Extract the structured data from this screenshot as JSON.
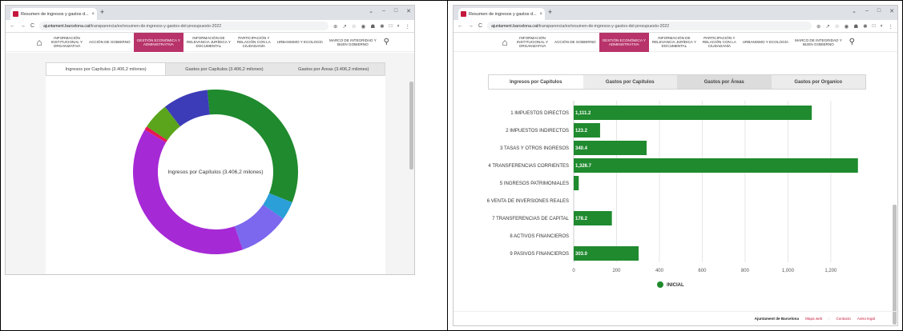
{
  "browser": {
    "tab_title": "Resumen de ingresos y gastos d...",
    "tab_close": "×",
    "new_tab": "+",
    "window_controls": [
      "⌄",
      "–",
      "□",
      "✕"
    ],
    "url_host": "ajuntament.barcelona.cat",
    "url_path": "/transparencia/es/resumen-de-ingresos-y-gastos-del-presupuesto-2022",
    "nav_back": "←",
    "nav_forward": "→",
    "nav_reload": "C",
    "lock": "🔒",
    "toolbar_icons": [
      "⊕",
      "↗",
      "☆",
      "◉",
      "☗",
      "✱",
      "□",
      "◐",
      "⋮"
    ]
  },
  "site_nav": {
    "home": "⌂",
    "items": [
      "INFORMACIÓN\nINSTITUCIONAL Y\nORGANIZATIVA",
      "ACCIÓN DE GOBIERNO",
      "GESTIÓN ECONÓMICA Y\nADMINISTRATIVA",
      "INFORMACIÓN DE\nRELEVANCIA JURÍDICA Y\nDOCUMENTAL",
      "PARTICIPACIÓN Y\nRELACIÓN CON LA\nCIUDADANÍA",
      "URBANISMO Y ECOLOGÍA",
      "MARCO DE INTEGRIDAD Y\nBUEN GOBIERNO"
    ],
    "active_index": 2,
    "search": "⚲"
  },
  "left_panel": {
    "tabs": [
      "Ingresos por Capítulos (3.406,2 milones)",
      "Gastos por Capítulos (3.406,2 milones)",
      "Gastos por Áreas (3.406,2 milones)"
    ],
    "donut_center_label": "Ingresos por Capítulos (3.406,2 milones)"
  },
  "right_panel": {
    "tabs": [
      "Ingresos por Capítulos",
      "Gastos por Capítulos",
      "Gastos por Áreas",
      "Gastos por Organico"
    ],
    "footer": {
      "brand": "Ajuntament de Barcelona",
      "links": [
        "Mapa web",
        "Contacto",
        "Aviso legal"
      ]
    }
  },
  "chart_data": [
    {
      "type": "pie",
      "title": "Ingresos por Capítulos (3.406,2 milones)",
      "categories": [
        "1 IMPUESTOS DIRECTOS",
        "2 IMPUESTOS INDIRECTOS",
        "3 TASAS Y OTROS INGRESOS",
        "4 TRANSFERENCIAS CORRIENTES",
        "5 INGRESOS PATRIMONIALES",
        "6 VENTA DE INVERSIONES REALES",
        "7 TRANSFERENCIAS DE CAPITAL",
        "8 ACTIVOS FINANCIEROS",
        "9 PASIVOS FINANCIEROS"
      ],
      "values": [
        1111.2,
        123.2,
        340.4,
        1326.7,
        23.6,
        0,
        178.2,
        0,
        303.0
      ],
      "colors": [
        "#1f8a2e",
        "#2a9fd8",
        "#7b68ee",
        "#a629d6",
        "#e8174f",
        "#999999",
        "#5aa51c",
        "#888888",
        "#3c3cb8"
      ]
    },
    {
      "type": "bar",
      "orientation": "horizontal",
      "categories": [
        "1 IMPUESTOS DIRECTOS",
        "2 IMPUESTOS INDIRECTOS",
        "3 TASAS Y OTROS INGRESOS",
        "4 TRANSFERENCIAS CORRIENTES",
        "5 INGRESOS PATRIMONIALES",
        "6 VENTA DE INVERSIONES REALES",
        "7 TRANSFERENCIAS DE CAPITAL",
        "8 ACTIVOS FINANCIEROS",
        "9 PASIVOS FINANCIEROS"
      ],
      "series": [
        {
          "name": "INICIAL",
          "values": [
            1111.2,
            123.2,
            340.4,
            1326.7,
            23.6,
            0,
            178.2,
            0,
            303.0
          ],
          "color": "#1f8a2e"
        }
      ],
      "data_labels": [
        "1,111.2",
        "123.2",
        "340.4",
        "1,326.7",
        "",
        "",
        "178.2",
        "",
        "303.0"
      ],
      "xticks": [
        "0",
        "200",
        "400",
        "600",
        "800",
        "1,000",
        "1,200"
      ],
      "xlim": [
        0,
        1350
      ],
      "grid": true,
      "legend": "bottom"
    }
  ]
}
